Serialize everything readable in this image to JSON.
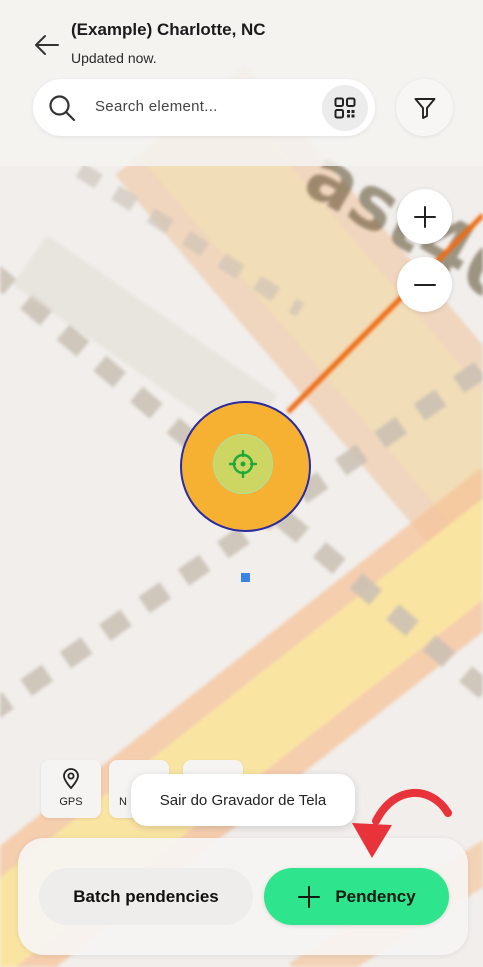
{
  "header": {
    "title": "(Example) Charlotte, NC",
    "subtitle": "Updated now.",
    "back_icon": "arrow-left-icon"
  },
  "search": {
    "placeholder": "Search element...",
    "search_icon": "search-icon",
    "qr_icon": "qr-code-icon",
    "filter_icon": "filter-icon"
  },
  "map": {
    "zoom_in_icon": "plus-icon",
    "zoom_out_icon": "minus-icon",
    "marker_icon": "crosshair-icon",
    "colors": {
      "marker_fill": "#f6b133",
      "marker_border": "#2a2ca0",
      "marker_inner": "#cdd563",
      "route_line": "#f06a12",
      "road_orange": "#f4b98a",
      "road_yellow": "#fbe9a0",
      "user_dot": "#3b82e6"
    },
    "road_label": "ast40"
  },
  "tools": {
    "gps_label": "GPS",
    "nearby_label": "N",
    "gps_icon": "location-pin-icon"
  },
  "toast": {
    "text": "Sair do Gravador de Tela"
  },
  "bottom": {
    "batch_label": "Batch pendencies",
    "pendency_label": "Pendency",
    "pendency_icon": "plus-icon",
    "accent_color": "#2ee48c"
  },
  "annotation": {
    "arrow_color": "#e8333a"
  }
}
